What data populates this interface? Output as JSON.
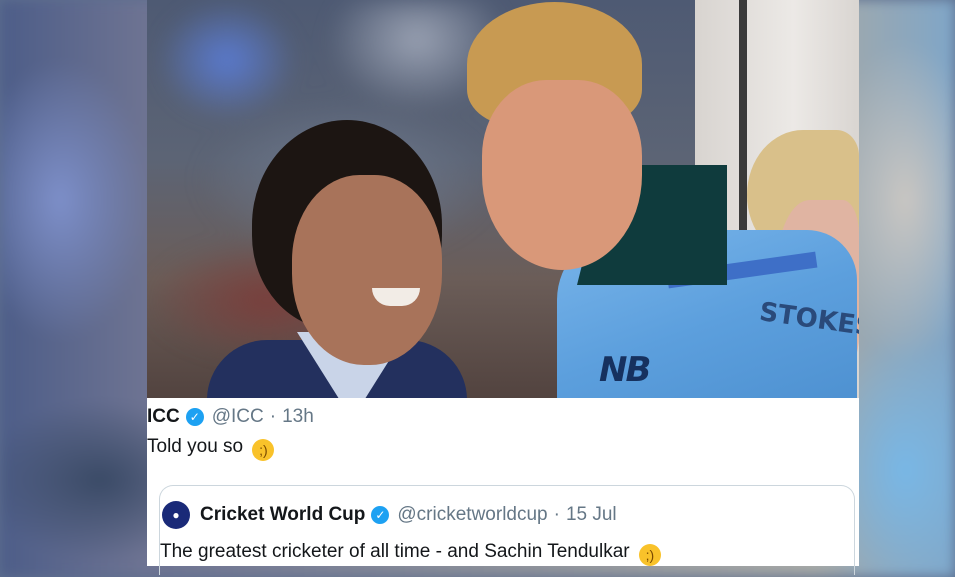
{
  "photo": {
    "jersey_brand": "NB",
    "jersey_name": "STOKES"
  },
  "tweet": {
    "author_name": "ICC",
    "verified_icon": "verified-badge-icon",
    "handle": "@ICC",
    "separator": "·",
    "time": "13h",
    "text": "Told you so",
    "emoji": "winking-face-emoji",
    "quoted": {
      "author_name": "Cricket World Cup",
      "verified_icon": "verified-badge-icon",
      "handle": "@cricketworldcup",
      "separator": "·",
      "date": "15 Jul",
      "text": "The greatest cricketer of all time - and Sachin Tendulkar",
      "emoji": "winking-face-emoji"
    }
  },
  "colors": {
    "verified_blue": "#1da1f2",
    "muted_text": "#657786",
    "primary_text": "#14171a",
    "card_border": "#ccd6dd"
  }
}
